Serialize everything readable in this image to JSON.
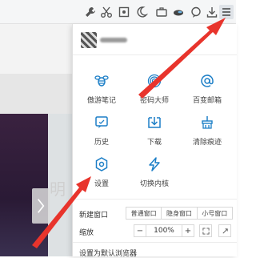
{
  "toolbar": {
    "icons": [
      "wrench-icon",
      "scissors-icon",
      "screenshot-icon",
      "night-mode-icon",
      "toolbox-icon",
      "brush-icon",
      "chat-icon",
      "download-icon",
      "menu-icon"
    ]
  },
  "account": {
    "name": ""
  },
  "menu": {
    "tiles": [
      {
        "label": "傲游笔记",
        "icon": "note-bee-icon"
      },
      {
        "label": "密码大师",
        "icon": "fingerprint-icon"
      },
      {
        "label": "百变邮箱",
        "icon": "mail-at-icon"
      },
      {
        "label": "历史",
        "icon": "history-icon"
      },
      {
        "label": "下载",
        "icon": "download-icon"
      },
      {
        "label": "清除痕迹",
        "icon": "clear-traces-icon"
      },
      {
        "label": "设置",
        "icon": "settings-icon"
      },
      {
        "label": "切换内核",
        "icon": "lightning-icon"
      }
    ],
    "new_window": {
      "label": "新建窗口",
      "options": [
        "普通窗口",
        "隐身窗口",
        "小号窗口"
      ]
    },
    "zoom": {
      "label": "缩放",
      "minus": "−",
      "value": "100%",
      "plus": "+"
    },
    "set_default": "设置为默认浏览器"
  },
  "page": {
    "partial_text": "明"
  },
  "colors": {
    "accent": "#1d7fc7",
    "arrow": "#e8342c"
  }
}
